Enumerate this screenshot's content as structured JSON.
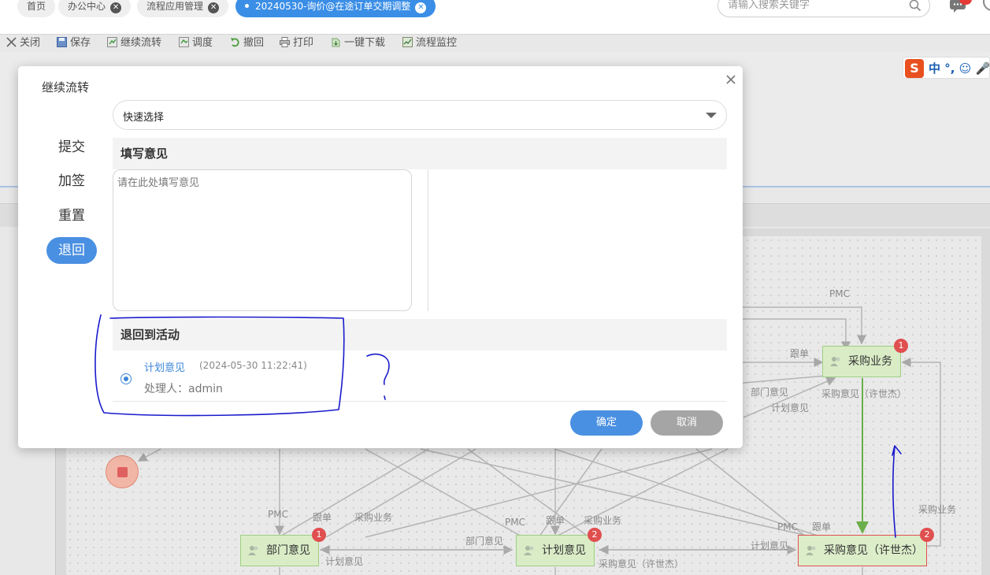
{
  "tabs": [
    {
      "label": "首页",
      "closable": false
    },
    {
      "label": "办公中心",
      "closable": true
    },
    {
      "label": "流程应用管理",
      "closable": true
    },
    {
      "label": "20240530-询价@在途订单交期调整",
      "closable": true,
      "active": true
    }
  ],
  "search": {
    "placeholder": "请输入搜索关键字"
  },
  "toolbar": {
    "close": "关闭",
    "save": "保存",
    "continue_flow": "继续流转",
    "schedule": "调度",
    "revoke": "撤回",
    "print": "打印",
    "download": "一键下载",
    "monitor": "流程监控"
  },
  "ime": {
    "label": "中 °, ☺ 🎤"
  },
  "dialog": {
    "title": "继续流转",
    "quick_select": {
      "value": "快速选择"
    },
    "side_menu": [
      "提交",
      "加签",
      "重置",
      "退回"
    ],
    "active_side": "退回",
    "opinion_header": "填写意见",
    "opinion_placeholder": "请在此处填写意见",
    "return_header": "退回到活动",
    "activity": {
      "name": "计划意见",
      "time": "(2024-05-30 11:22:41)",
      "handler": "处理人：admin"
    },
    "ok_label": "确定",
    "cancel_label": "取消"
  },
  "flow": {
    "nodes": {
      "purchase_business": {
        "label": "采购业务",
        "badge": "1"
      },
      "dept_opinion": {
        "label": "部门意见",
        "badge": "1"
      },
      "plan_opinion": {
        "label": "计划意见",
        "badge": "2"
      },
      "purchase_opinion": {
        "label": "采购意见（许世杰）",
        "badge": "2"
      }
    },
    "edge_labels": {
      "pmc_top": "PMC",
      "gendan_top": "跟单",
      "bumen_mid": "部门意见",
      "jihua_mid": "计划意见",
      "caigou_xsj_mid": "采购意见（许世杰）",
      "caigou_yewu_right": "采购业务",
      "pmc_dept": "PMC",
      "gendan_dept": "跟单",
      "caigou_yewu_dept": "采购业务",
      "jihua_dept": "计划意见",
      "bumen_plan": "部门意见",
      "pmc_plan": "PMC",
      "gendan_plan": "跟单",
      "caigou_yewu_plan": "采购业务",
      "caigou_xsj_plan": "采购意见（许世杰）",
      "pmc_purchase": "PMC",
      "gendan_purchase": "跟单",
      "jihua_purchase": "计划意见"
    }
  },
  "colors": {
    "accent": "#4a90e2",
    "node_fill": "#d9ecc6",
    "badge": "#e04f4f",
    "annotation": "#1a1acc"
  }
}
